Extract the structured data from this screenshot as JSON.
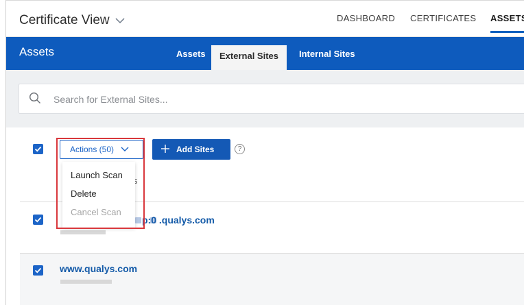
{
  "app": {
    "title": "Certificate View"
  },
  "topnav": {
    "items": [
      "DASHBOARD",
      "CERTIFICATES",
      "ASSETS"
    ],
    "active": "ASSETS"
  },
  "header": {
    "title": "Assets",
    "tabs": [
      "Assets",
      "External Sites",
      "Internal Sites"
    ],
    "active_tab": "External Sites"
  },
  "search": {
    "placeholder": "Search for External Sites..."
  },
  "toolbar": {
    "actions_label": "Actions (50)",
    "add_label": "Add Sites",
    "help": "?"
  },
  "dropdown": {
    "items": [
      {
        "label": "Launch Scan",
        "enabled": true
      },
      {
        "label": "Delete",
        "enabled": true
      },
      {
        "label": "Cancel Scan",
        "enabled": false
      }
    ]
  },
  "hidden_char": "s",
  "rows": [
    {
      "name": "p:0 .qualys.com",
      "selected": true
    },
    {
      "name": "www.qualys.com",
      "selected": true
    }
  ],
  "colors": {
    "primary": "#0e5bbd",
    "highlight": "#d9373c",
    "link": "#135aa8"
  }
}
